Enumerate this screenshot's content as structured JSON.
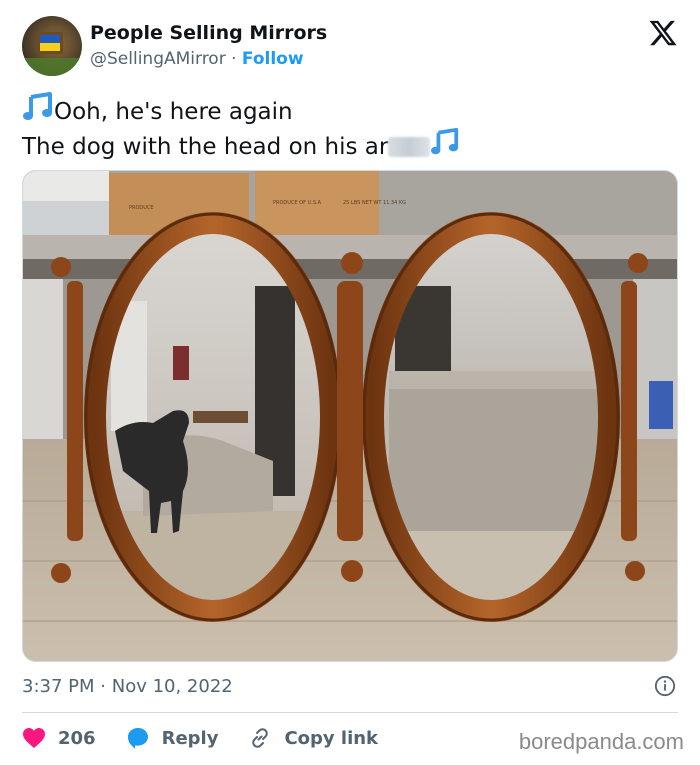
{
  "author": {
    "name": "People Selling Mirrors",
    "handle": "@SellingAMirror",
    "separator": "·",
    "follow_label": "Follow"
  },
  "tweet": {
    "line1": "Ooh, he's here again",
    "line2": "The dog with the head on his ar"
  },
  "media": {
    "box_texts": [
      "PRODUCE",
      "PRODUCE OF U.S.A",
      "25 LBS NET WT 11.34 KG"
    ]
  },
  "meta": {
    "time": "3:37 PM",
    "separator": "·",
    "date": "Nov 10, 2022"
  },
  "actions": {
    "likes": "206",
    "reply_label": "Reply",
    "copy_label": "Copy link"
  },
  "watermark": "boredpanda.com",
  "colors": {
    "accent": "#1d9bf0",
    "like": "#f91880",
    "text": "#0f1419",
    "muted": "#536471",
    "note": "#3b9ae8"
  },
  "icons": [
    "x-logo-icon",
    "music-note-icon",
    "info-icon",
    "heart-icon",
    "reply-bubble-icon",
    "link-icon"
  ]
}
